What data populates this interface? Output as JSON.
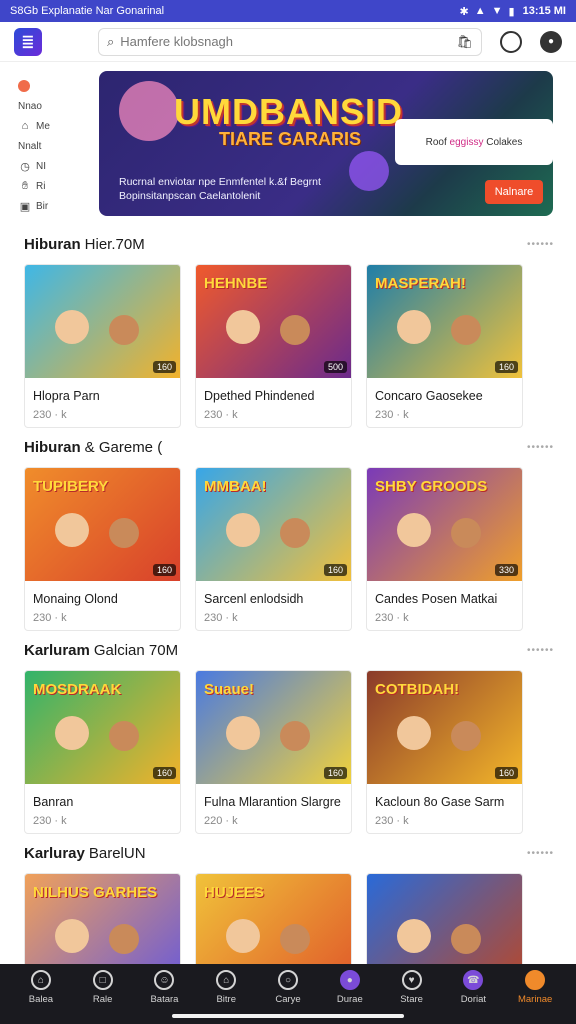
{
  "status_bar": {
    "left": "S8Gb Explanatie Nar Gonarinal",
    "icons": [
      "bluetooth-icon",
      "signal-icon",
      "wifi-icon",
      "battery-icon"
    ],
    "time": "13:15 MI"
  },
  "app_bar": {
    "search_placeholder": "Hamfere klobsnagh",
    "icons": [
      "cart-icon",
      "notification-icon",
      "profile-icon"
    ]
  },
  "side_nav": {
    "items": [
      {
        "icon": "home-dot-icon",
        "label": ""
      },
      {
        "icon": "",
        "label": "Nnao"
      },
      {
        "icon": "home-icon",
        "label": "Me"
      },
      {
        "icon": "",
        "label": "Nnalt"
      },
      {
        "icon": "clock-icon",
        "label": "NI"
      },
      {
        "icon": "hand-icon",
        "label": "Ri"
      },
      {
        "icon": "gift-icon",
        "label": "Bir"
      }
    ]
  },
  "hero": {
    "title": "UMDBANSID",
    "subtitle": "TIARE GARARIS",
    "description": "Rucrnal enviotar npe Enmfentel k.&f Begrnt Bopinsitanpscan Caelantolenit",
    "card_text_a": "Roof",
    "card_text_b": "eggissy",
    "card_text_c": "Colakes",
    "button_label": "Nalnare"
  },
  "sections": [
    {
      "title": "Hiburan",
      "subtitle": "Hier.70M",
      "tiles": [
        {
          "name": "Hlopra Parn",
          "count": "230 · k",
          "badge": "160",
          "logo": "",
          "bg": [
            "#3fb7e6",
            "#f3b22a"
          ]
        },
        {
          "name": "Dpethed Phindened",
          "count": "230 · k",
          "badge": "500",
          "logo": "HEHNBE",
          "bg": [
            "#f05a2c",
            "#6a2a8c"
          ]
        },
        {
          "name": "Concaro Gaosekee",
          "count": "230 · k",
          "badge": "160",
          "logo": "MASPERAH!",
          "bg": [
            "#1f7ea8",
            "#f1c23a"
          ]
        }
      ]
    },
    {
      "title": "Hiburan",
      "subtitle": "& Gareme (",
      "tiles": [
        {
          "name": "Monaing Olond",
          "count": "230 · k",
          "badge": "160",
          "logo": "TUPIBERY",
          "bg": [
            "#f08d2b",
            "#d8402b"
          ]
        },
        {
          "name": "Sarcenl enlodsidh",
          "count": "230 · k",
          "badge": "160",
          "logo": "MMBAA!",
          "bg": [
            "#37a6e8",
            "#f3c03a"
          ]
        },
        {
          "name": "Candes Posen Matkai",
          "count": "230 · k",
          "badge": "330",
          "logo": "SHBY GROODS",
          "bg": [
            "#7a3ab8",
            "#f0a02a"
          ]
        }
      ]
    },
    {
      "title": "Karluram",
      "subtitle": "Galcian 70M",
      "tiles": [
        {
          "name": "Banran",
          "count": "230 · k",
          "badge": "160",
          "logo": "MOSDRAAK",
          "bg": [
            "#32b36a",
            "#f3b22a"
          ]
        },
        {
          "name": "Fulna Mlarantion Slargre",
          "count": "220 · k",
          "badge": "160",
          "logo": "Suaue!",
          "bg": [
            "#4a7ae0",
            "#f2d23a"
          ]
        },
        {
          "name": "Kacloun 8o Gase Sarm",
          "count": "230 · k",
          "badge": "160",
          "logo": "COTBIDAH!",
          "bg": [
            "#8a3a2a",
            "#f4b72a"
          ]
        }
      ]
    },
    {
      "title": "Karluray",
      "subtitle": "BarelUN",
      "tiles": [
        {
          "name": "",
          "count": "",
          "badge": "",
          "logo": "NILHUS GARHES",
          "bg": [
            "#f0a15a",
            "#6a5ad8"
          ]
        },
        {
          "name": "",
          "count": "",
          "badge": "",
          "logo": "HUJEES",
          "bg": [
            "#f0c23a",
            "#e05a2a"
          ]
        },
        {
          "name": "",
          "count": "",
          "badge": "",
          "logo": "",
          "bg": [
            "#2a6ad8",
            "#b8482a"
          ]
        }
      ]
    }
  ],
  "bottom_nav": [
    {
      "label": "Balea",
      "icon": "home-icon"
    },
    {
      "label": "Rale",
      "icon": "square-icon"
    },
    {
      "label": "Batara",
      "icon": "smile-icon"
    },
    {
      "label": "Bitre",
      "icon": "house-icon"
    },
    {
      "label": "Carye",
      "icon": "chat-icon"
    },
    {
      "label": "Durae",
      "icon": "purple-dot-icon"
    },
    {
      "label": "Stare",
      "icon": "heart-icon"
    },
    {
      "label": "Doriat",
      "icon": "phone-icon"
    },
    {
      "label": "Marinae",
      "icon": "orange-dot-icon"
    }
  ]
}
